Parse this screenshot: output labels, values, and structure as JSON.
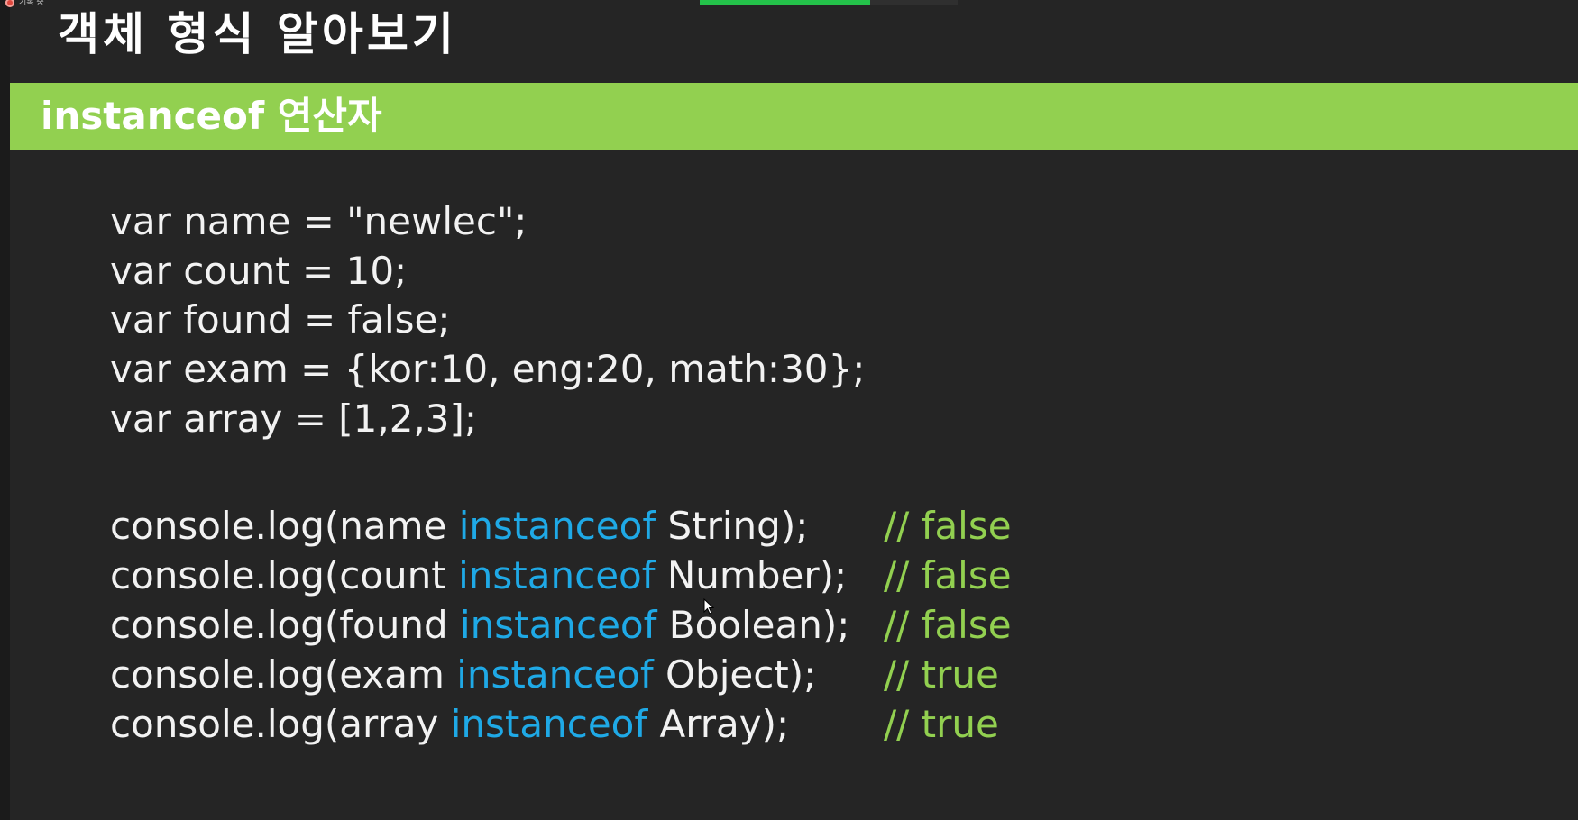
{
  "recording": {
    "label": "기록 중"
  },
  "progress": {
    "fraction": 0.66
  },
  "slide": {
    "title": "객체 형식 알아보기",
    "section": "instanceof 연산자"
  },
  "code": {
    "declarations": [
      "var name = \"newlec\";",
      "var count = 10;",
      "var found = false;",
      "var exam = {kor:10, eng:20, math:30};",
      "var array = [1,2,3];"
    ],
    "checks": [
      {
        "prefix": "console.log(name ",
        "keyword": "instanceof",
        "suffix": " String);",
        "comment": "// false"
      },
      {
        "prefix": "console.log(count ",
        "keyword": "instanceof",
        "suffix": " Number);",
        "comment": "// false"
      },
      {
        "prefix": "console.log(found ",
        "keyword": "instanceof",
        "suffix": " Boolean);",
        "comment": "// false"
      },
      {
        "prefix": "console.log(exam ",
        "keyword": "instanceof",
        "suffix": " Object);",
        "comment": "// true"
      },
      {
        "prefix": "console.log(array ",
        "keyword": "instanceof",
        "suffix": " Array);",
        "comment": "// true"
      }
    ]
  },
  "colors": {
    "background": "#252525",
    "section_bar": "#92d050",
    "keyword": "#1fa9e6",
    "comment": "#92d050",
    "progress": "#24c24a"
  }
}
